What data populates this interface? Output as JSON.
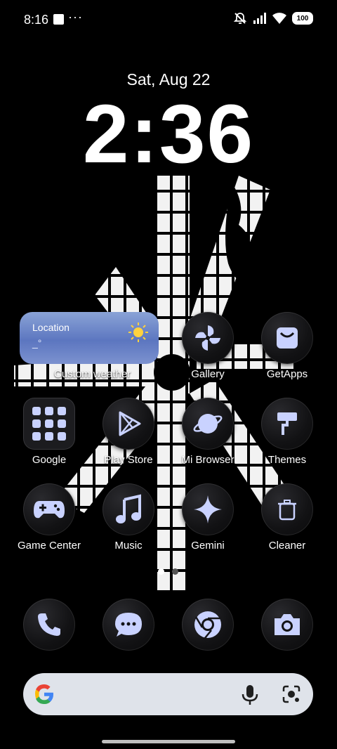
{
  "status_bar": {
    "time": "8:16",
    "more": "···",
    "battery": "100",
    "icons": [
      "notification-square-icon",
      "mute-icon",
      "signal-icon",
      "wifi-icon",
      "battery-icon"
    ]
  },
  "lockscreen": {
    "date": "Sat, Aug 22",
    "time": "2:36"
  },
  "weather_widget": {
    "location": "Location",
    "temperature": "_°",
    "label": "Custom weather"
  },
  "apps": {
    "row1": [
      {
        "label": "Gallery",
        "icon": "pinwheel-icon"
      },
      {
        "label": "GetApps",
        "icon": "shopping-bag-icon"
      }
    ],
    "row2": [
      {
        "label": "Google",
        "icon": "folder-icon"
      },
      {
        "label": "Play Store",
        "icon": "play-triangle-icon"
      },
      {
        "label": "Mi Browser",
        "icon": "planet-icon"
      },
      {
        "label": "Themes",
        "icon": "paint-roller-icon"
      }
    ],
    "row3": [
      {
        "label": "Game Center",
        "icon": "gamepad-icon"
      },
      {
        "label": "Music",
        "icon": "music-note-icon"
      },
      {
        "label": "Gemini",
        "icon": "sparkle-icon"
      },
      {
        "label": "Cleaner",
        "icon": "trash-can-icon"
      }
    ]
  },
  "dock": [
    {
      "icon": "phone-icon"
    },
    {
      "icon": "messages-icon"
    },
    {
      "icon": "chrome-icon"
    },
    {
      "icon": "camera-icon"
    }
  ],
  "search_bar": {
    "icons": [
      "google-g-icon",
      "microphone-icon",
      "lens-icon"
    ]
  },
  "page_indicator": {
    "pages": 2,
    "active": 1
  },
  "colors": {
    "accent": "#c9d2ff",
    "icon_bg": "#141416"
  }
}
